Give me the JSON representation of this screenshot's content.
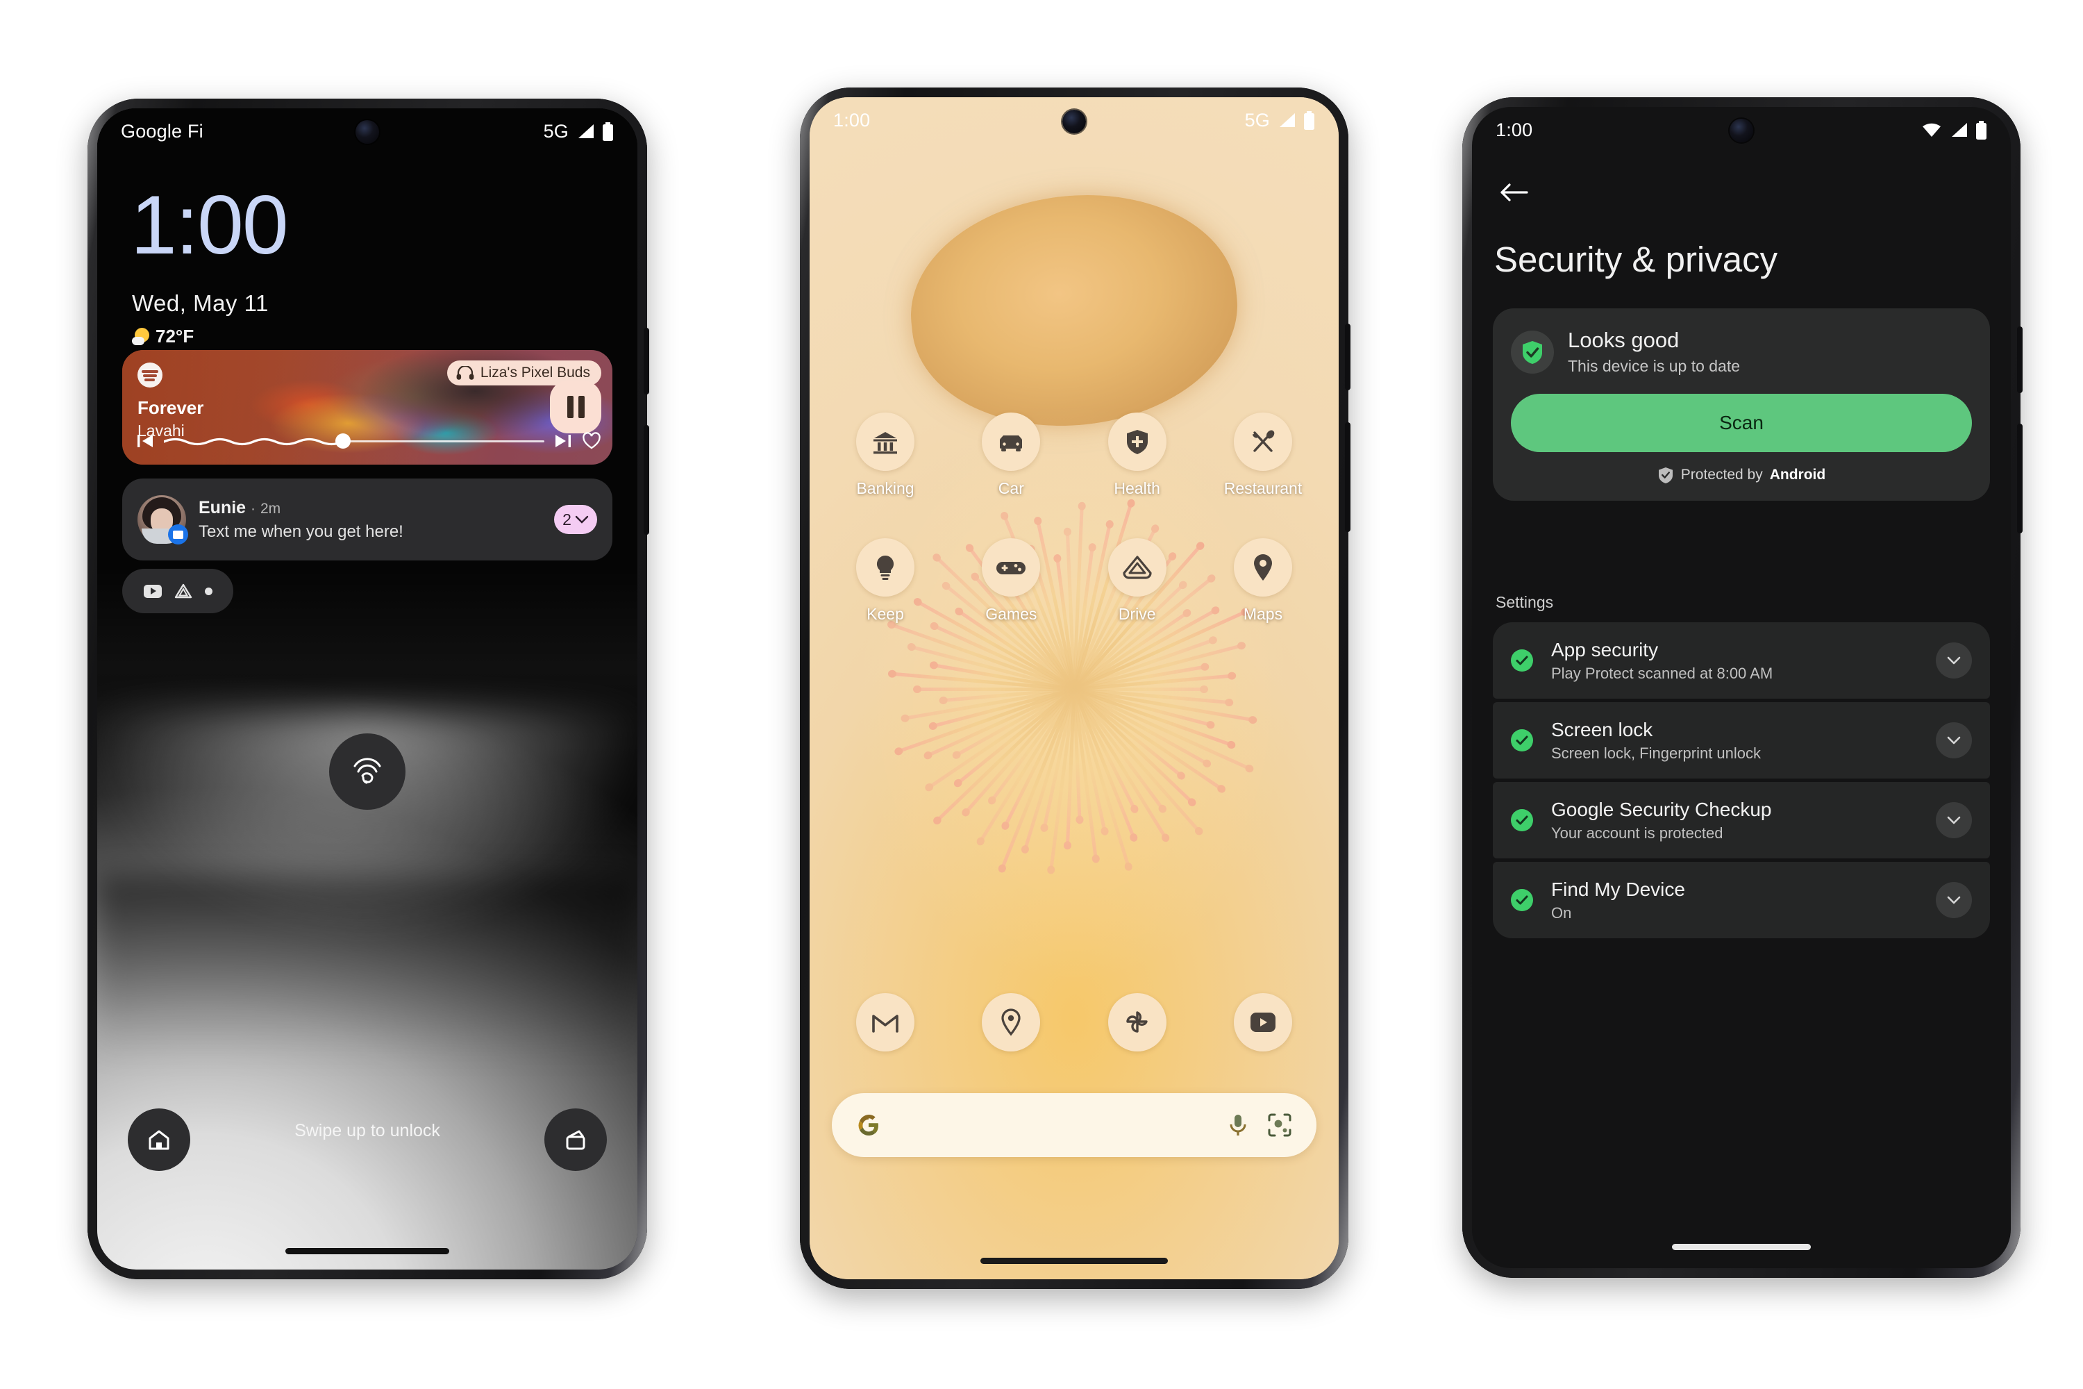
{
  "phones": [
    {
      "name": "lock-screen",
      "status_bar": {
        "carrier": "Google Fi",
        "network": "5G"
      },
      "clock": "1:00",
      "date": "Wed, May 11",
      "weather": {
        "temperature": "72°F",
        "icon": "partly-sunny-icon"
      },
      "media_widget": {
        "app_icon": "spotify-icon",
        "output_device": "Liza's Pixel Buds",
        "output_icon": "headphones-icon",
        "track_title": "Forever",
        "artist": "Lavahi",
        "progress_percent": 47,
        "prev_icon": "skip-previous-icon",
        "next_icon": "skip-next-icon",
        "like_icon": "heart-icon",
        "play_state_icon": "pause-icon"
      },
      "notification": {
        "sender": "Eunie",
        "time": "2m",
        "separator": "·",
        "message": "Text me when you get here!",
        "count": "2",
        "expand_icon": "chevron-down-icon",
        "app_badge_icon": "messages-icon"
      },
      "notification_chips": [
        "youtube-icon",
        "drive-icon",
        "more-dot-icon"
      ],
      "fingerprint_icon": "fingerprint-icon",
      "unlock_hint": "Swipe up to unlock",
      "left_button_icon": "home-control-icon",
      "right_button_icon": "wallet-icon"
    },
    {
      "name": "home-screen",
      "status_bar": {
        "time": "1:00",
        "network": "5G"
      },
      "apps_row1": [
        {
          "label": "Banking",
          "icon": "bank-icon"
        },
        {
          "label": "Car",
          "icon": "car-icon"
        },
        {
          "label": "Health",
          "icon": "health-shield-icon"
        },
        {
          "label": "Restaurant",
          "icon": "fork-spoon-icon"
        }
      ],
      "apps_row2": [
        {
          "label": "Keep",
          "icon": "lightbulb-icon"
        },
        {
          "label": "Games",
          "icon": "gamepad-icon"
        },
        {
          "label": "Drive",
          "icon": "drive-icon"
        },
        {
          "label": "Maps",
          "icon": "map-pin-icon"
        }
      ],
      "dock": [
        {
          "label": "Gmail",
          "icon": "gmail-icon"
        },
        {
          "label": "Maps",
          "icon": "maps-pin-icon"
        },
        {
          "label": "Photos",
          "icon": "photos-pinwheel-icon"
        },
        {
          "label": "YouTube",
          "icon": "youtube-icon"
        }
      ],
      "search": {
        "logo_icon": "google-g-icon",
        "placeholder": "",
        "mic_icon": "microphone-icon",
        "lens_icon": "google-lens-icon"
      }
    },
    {
      "name": "security-privacy",
      "status_bar": {
        "time": "1:00",
        "wifi": "wifi-icon",
        "signal": "signal-icon",
        "battery": "battery-icon"
      },
      "back_icon": "back-arrow-icon",
      "title": "Security & privacy",
      "status_card": {
        "icon": "green-shield-check-icon",
        "headline": "Looks good",
        "subtext": "This device is up to date",
        "button_label": "Scan",
        "footer_icon": "shield-icon",
        "footer_prefix": "Protected by ",
        "footer_brand": "Android",
        "accent_color": "#5ec77e"
      },
      "section_label": "Settings",
      "settings_items": [
        {
          "title": "App security",
          "subtitle": "Play Protect scanned at 8:00 AM",
          "status_icon": "check-circle-icon",
          "expand_icon": "chevron-down-icon"
        },
        {
          "title": "Screen lock",
          "subtitle": "Screen lock, Fingerprint unlock",
          "status_icon": "check-circle-icon",
          "expand_icon": "chevron-down-icon"
        },
        {
          "title": "Google Security Checkup",
          "subtitle": "Your account is protected",
          "status_icon": "check-circle-icon",
          "expand_icon": "chevron-down-icon"
        },
        {
          "title": "Find My Device",
          "subtitle": "On",
          "status_icon": "check-circle-icon",
          "expand_icon": "chevron-down-icon"
        }
      ]
    }
  ]
}
